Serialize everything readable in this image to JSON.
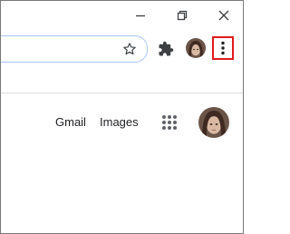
{
  "window_controls": {
    "minimize_icon": "minimize-icon",
    "restore_icon": "restore-icon",
    "close_icon": "close-icon"
  },
  "toolbar": {
    "bookmark_icon": "star-icon",
    "extensions_icon": "puzzle-piece-icon",
    "profile_icon": "profile-avatar",
    "menu_icon": "three-dots-vertical-icon",
    "highlight_color": "#e01b1b"
  },
  "page": {
    "gmail_label": "Gmail",
    "images_label": "Images",
    "apps_icon": "apps-grid-icon",
    "account_icon": "account-avatar"
  },
  "colors": {
    "omnibox_border": "#a8c7fa",
    "icon": "#3c4043",
    "text": "#202124"
  }
}
